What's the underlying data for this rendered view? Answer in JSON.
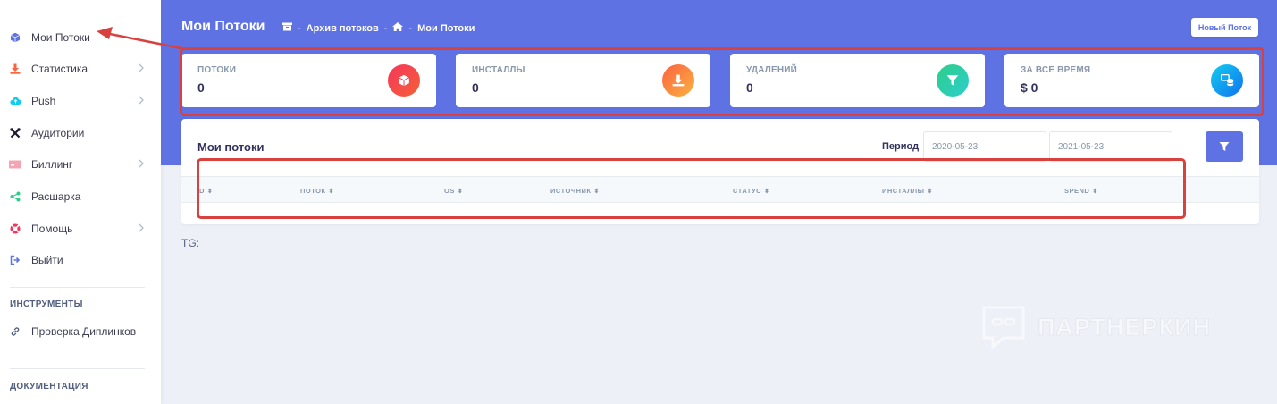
{
  "sidebar": {
    "items": [
      {
        "label": "Мои Потоки",
        "icon": "cube-icon",
        "has_submenu": false
      },
      {
        "label": "Статистика",
        "icon": "download-icon",
        "has_submenu": true
      },
      {
        "label": "Push",
        "icon": "cloud-upload-icon",
        "has_submenu": true
      },
      {
        "label": "Аудитории",
        "icon": "tools-icon",
        "has_submenu": false
      },
      {
        "label": "Биллинг",
        "icon": "credit-card-icon",
        "has_submenu": true
      },
      {
        "label": "Расшарка",
        "icon": "share-icon",
        "has_submenu": false
      },
      {
        "label": "Помощь",
        "icon": "lifebuoy-icon",
        "has_submenu": true
      },
      {
        "label": "Выйти",
        "icon": "logout-icon",
        "has_submenu": false
      }
    ],
    "tools_heading": "ИНСТРУМЕНТЫ",
    "tools_items": [
      {
        "label": "Проверка Диплинков",
        "icon": "link-icon"
      }
    ],
    "docs_heading": "ДОКУМЕНТАЦИЯ"
  },
  "header": {
    "title": "Мои Потоки",
    "breadcrumb": [
      "Архив потоков",
      "Мои Потоки"
    ],
    "new_button": "Новый Поток"
  },
  "stats": [
    {
      "label": "ПОТОКИ",
      "value": "0",
      "icon": "cube-icon",
      "color": "#f5365c"
    },
    {
      "label": "ИНСТАЛЛЫ",
      "value": "0",
      "icon": "download-icon",
      "color": "#fb6340"
    },
    {
      "label": "УДАЛЕНИЙ",
      "value": "0",
      "icon": "filter-icon",
      "color": "#2dce89"
    },
    {
      "label": "ЗА ВСЕ ВРЕМЯ",
      "value": "$ 0",
      "icon": "database-icon",
      "color": "#11cdef"
    }
  ],
  "main": {
    "title": "Мои потоки",
    "period_label": "Период",
    "date_from": "2020-05-23",
    "date_to": "2021-05-23",
    "columns": [
      "D",
      "ПОТОК",
      "OS",
      "ИСТОЧНИК",
      "СТАТУС",
      "ИНСТАЛЛЫ",
      "SPEND"
    ]
  },
  "footer_text": "TG:",
  "watermark": "ПАРТНЕРКИН",
  "colors": {
    "primary": "#5e72e4",
    "annotation": "#d9413f"
  }
}
